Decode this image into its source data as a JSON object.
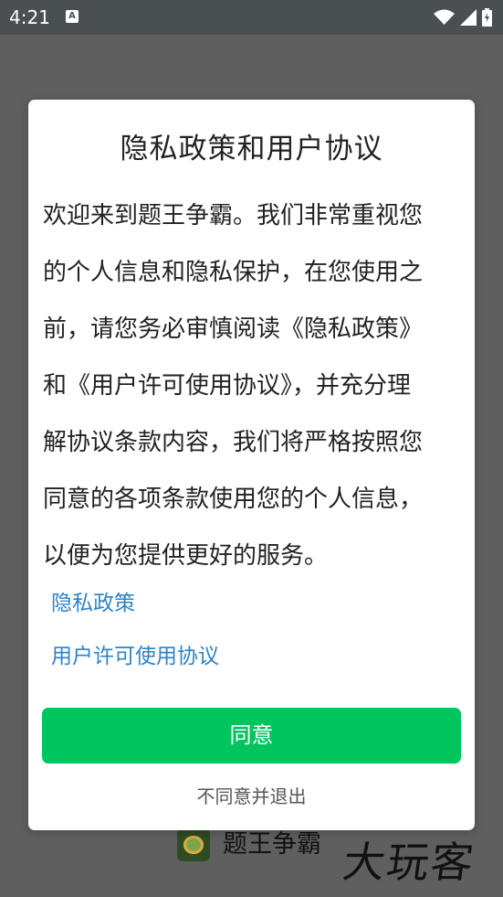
{
  "status_bar": {
    "time": "4:21",
    "notification_icon": "a-icon",
    "wifi_icon": "wifi-icon",
    "signal_icon": "signal-icon",
    "battery_icon": "battery-icon"
  },
  "app": {
    "name": "题王争霸",
    "watermark": "大玩客"
  },
  "dialog": {
    "title": "隐私政策和用户协议",
    "body_lines": [
      "欢迎来到题王争霸。我们非常重视您",
      "的个人信息和隐私保护，在您使用之",
      "前，请您务必审慎阅读《隐私政策》",
      "和《用户许可使用协议》，并充分理",
      "解协议条款内容，我们将严格按照您",
      "同意的各项条款使用您的个人信息，",
      "以便为您提供更好的服务。"
    ],
    "privacy_link": "隐私政策",
    "license_link": "用户许可使用协议",
    "agree_label": "同意",
    "disagree_label": "不同意并退出"
  },
  "colors": {
    "status_bar": "#4a4f52",
    "backdrop": "#5f5f5f",
    "link": "#2d84c8",
    "agree_button": "#00c55f"
  }
}
